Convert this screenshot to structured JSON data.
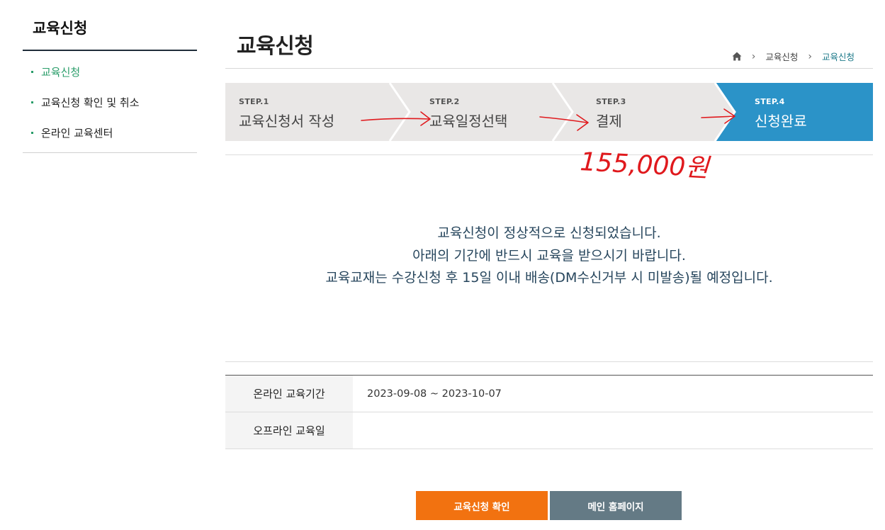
{
  "sidebar": {
    "title": "교육신청",
    "items": [
      {
        "label": "교육신청",
        "active": true
      },
      {
        "label": "교육신청 확인 및 취소",
        "active": false
      },
      {
        "label": "온라인 교육센터",
        "active": false
      }
    ]
  },
  "header": {
    "title": "교육신청",
    "breadcrumb": [
      "교육신청",
      "교육신청"
    ],
    "home_icon": "home-icon"
  },
  "steps": [
    {
      "num": "STEP.1",
      "label": "교육신청서 작성"
    },
    {
      "num": "STEP.2",
      "label": "교육일정선택"
    },
    {
      "num": "STEP.3",
      "label": "결제"
    },
    {
      "num": "STEP.4",
      "label": "신청완료"
    }
  ],
  "annotation": {
    "handwritten_amount": "155,000원"
  },
  "message": {
    "line1": "교육신청이 정상적으로 신청되었습니다.",
    "line2": "아래의 기간에 반드시 교육을 받으시기 바랍니다.",
    "line3": "교육교재는 수강신청 후 15일 이내 배송(DM수신거부 시 미발송)될 예정입니다."
  },
  "info": {
    "online_label": "온라인 교육기간",
    "online_value": "2023-09-08 ~ 2023-10-07",
    "offline_label": "오프라인 교육일",
    "offline_value": ""
  },
  "buttons": {
    "confirm": "교육신청 확인",
    "home": "메인 홈페이지"
  },
  "colors": {
    "accent_green": "#2a9d6a",
    "active_step": "#2b93c8",
    "inactive_step": "#e9e7e6",
    "orange_button": "#f27210",
    "gray_button": "#647a85",
    "annotation_red": "#e0191d"
  }
}
